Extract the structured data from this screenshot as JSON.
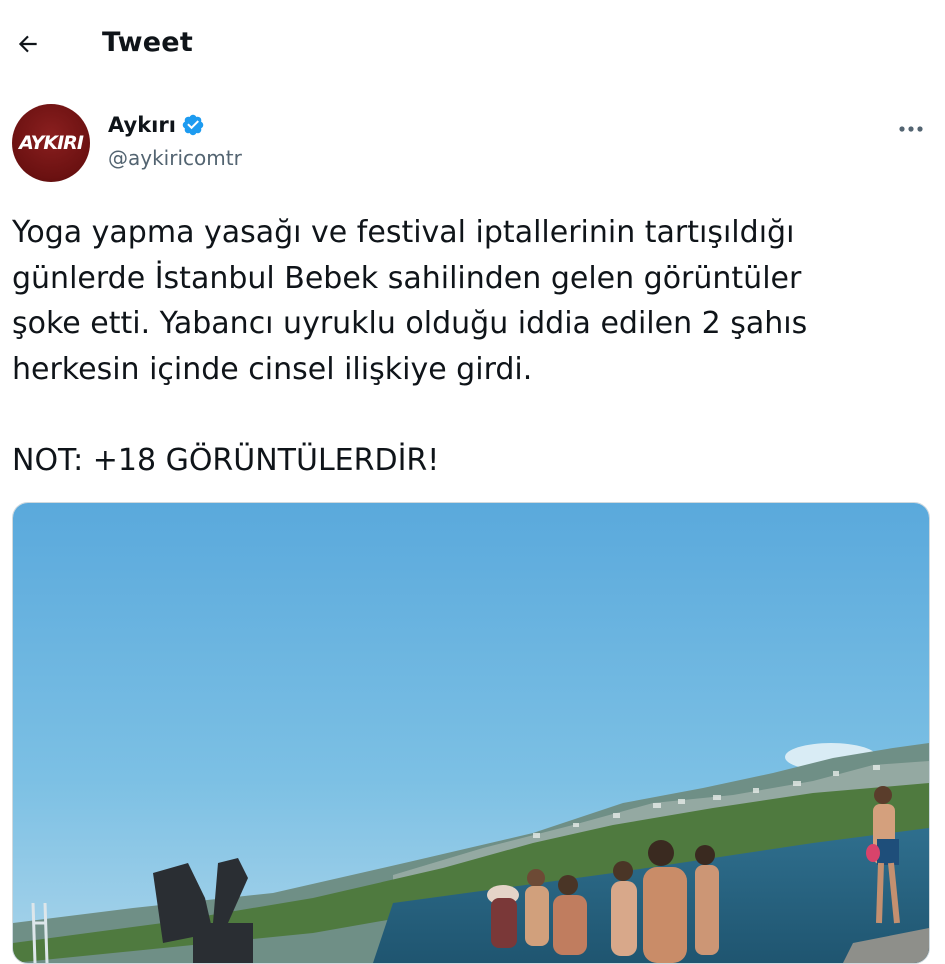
{
  "header": {
    "title": "Tweet",
    "back_icon": "arrow-left-icon"
  },
  "author": {
    "avatar_text": "AYKIRI",
    "avatar_color": "#6b1111",
    "display_name": "Aykırı",
    "verified_icon": "verified-badge-icon",
    "verified_color": "#1d9bf0",
    "handle": "@aykiricomtr",
    "more_icon": "more-horizontal-icon"
  },
  "tweet": {
    "text": "Yoga yapma yasağı ve festival iptallerinin tartışıldığı\ngünlerde İstanbul Bebek sahilinden gelen görüntüler\nşoke etti. Yabancı uyruklu olduğu iddia edilen 2 şahıs\nherkesin içinde cinsel ilişkiye girdi.\n\nNOT: +18 GÖRÜNTÜLERDİR!"
  },
  "media": {
    "type": "video-thumbnail",
    "scene": "beach-seaside-photo"
  }
}
